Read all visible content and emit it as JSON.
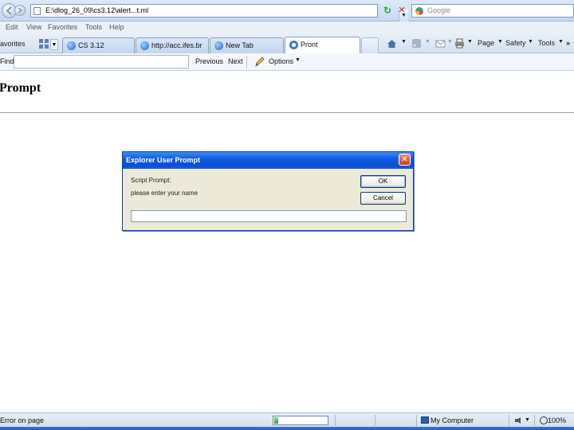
{
  "address_bar": {
    "url": "E:\\dlog_26_09\\cs3.12\\alert...t.ml",
    "search_placeholder": "Google"
  },
  "menu": {
    "items": [
      "Edit",
      "View",
      "Favorites",
      "Tools",
      "Help"
    ]
  },
  "tab_bar": {
    "favorites_label": "avorites",
    "tabs": [
      {
        "label": "CS 3.12"
      },
      {
        "label": "http://acc.ifes.br"
      },
      {
        "label": "New Tab"
      },
      {
        "label": "Pront"
      }
    ],
    "commands": {
      "page": "Page",
      "safety": "Safety",
      "tools": "Tools"
    }
  },
  "find_bar": {
    "label": "Find:",
    "previous": "Previous",
    "next": "Next",
    "options": "Options"
  },
  "page": {
    "heading": "Prompt"
  },
  "dialog": {
    "title": "Explorer User Prompt",
    "script_prompt": "Script Prompt:",
    "message": "please enter your name",
    "ok_label": "OK",
    "cancel_label": "Cancel",
    "input_value": ""
  },
  "status_bar": {
    "text": "Error on page",
    "progress_fraction": 0.08,
    "zone": "My Computer",
    "zoom": "100%"
  },
  "colors": {
    "title_bar": "#0a4fd3",
    "dialog_face": "#ece9d8",
    "chrome_blue": "#c6d9f1"
  }
}
